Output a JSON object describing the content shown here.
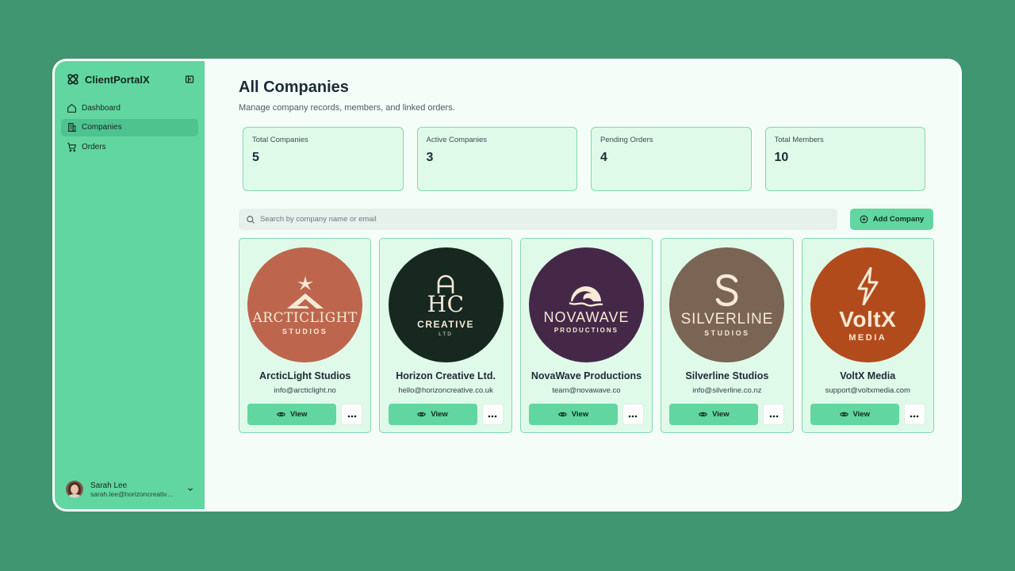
{
  "app": {
    "name": "ClientPortalX"
  },
  "sidebar": {
    "items": [
      {
        "label": "Dashboard",
        "icon": "home-icon"
      },
      {
        "label": "Companies",
        "icon": "building-icon",
        "active": true
      },
      {
        "label": "Orders",
        "icon": "cart-icon"
      }
    ],
    "user": {
      "name": "Sarah Lee",
      "email": "sarah.lee@horizoncreative.co.uk"
    }
  },
  "page": {
    "title": "All Companies",
    "subtitle": "Manage company records, members, and linked orders."
  },
  "stats": [
    {
      "label": "Total Companies",
      "value": "5"
    },
    {
      "label": "Active Companies",
      "value": "3"
    },
    {
      "label": "Pending Orders",
      "value": "4"
    },
    {
      "label": "Total Members",
      "value": "10"
    }
  ],
  "search": {
    "placeholder": "Search by company name or email"
  },
  "add_button": {
    "label": "Add Company"
  },
  "companies": [
    {
      "name": "ArcticLight Studios",
      "email": "info@arcticlight.no",
      "logo_main": "ARCTICLIGHT",
      "logo_sub": "STUDIOS",
      "color": "#bd664d"
    },
    {
      "name": "Horizon Creative Ltd.",
      "email": "hello@horizoncreative.co.uk",
      "logo_main": "HC",
      "logo_sub": "CREATIVE",
      "logo_sub2": "LTD",
      "color": "#16281f"
    },
    {
      "name": "NovaWave Productions",
      "email": "team@novawave.co",
      "logo_main": "NOVAWAVE",
      "logo_sub": "PRODUCTIONS",
      "color": "#452848"
    },
    {
      "name": "Silverline Studios",
      "email": "info@silverline.co.nz",
      "logo_main": "SILVERLINE",
      "logo_sub": "STUDIOS",
      "color": "#7a6453"
    },
    {
      "name": "VoltX Media",
      "email": "support@voltxmedia.com",
      "logo_main": "VoltX",
      "logo_sub": "MEDIA",
      "color": "#b24b1c"
    }
  ],
  "card_actions": {
    "view_label": "View"
  },
  "colors": {
    "background": "#3f9670",
    "sidebar": "#62d6a0",
    "card": "#e0faea",
    "accent": "#62d6a0"
  }
}
